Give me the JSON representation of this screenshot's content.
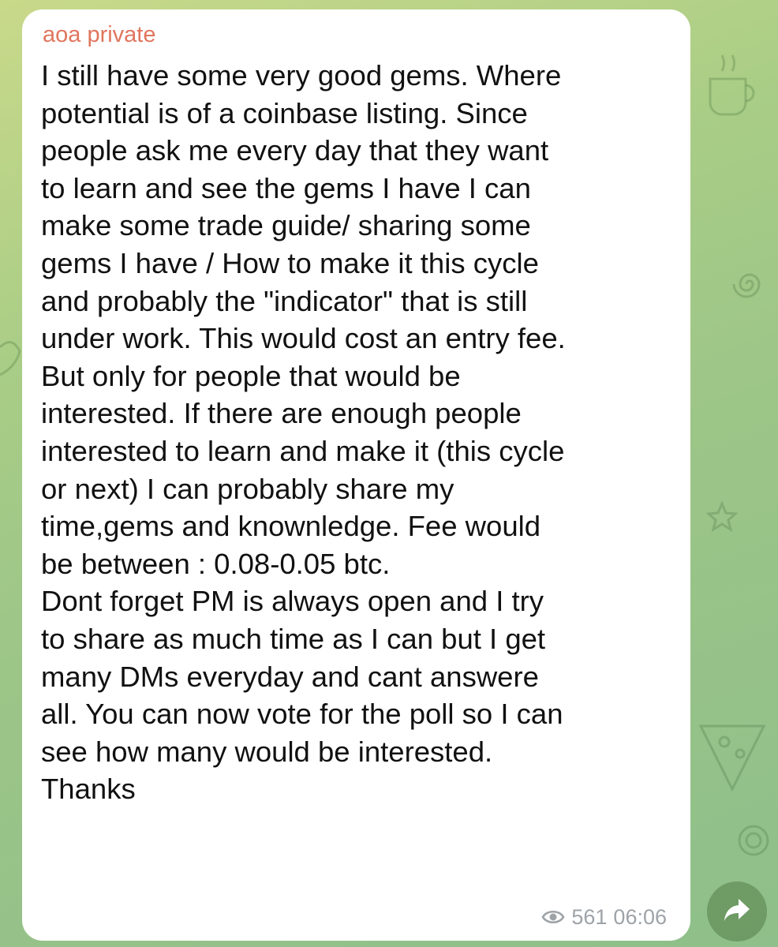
{
  "message": {
    "sender": "aoa private",
    "lines": [
      "I still have some very good gems. Where",
      "potential is of a coinbase listing. Since",
      "people ask me every day that they want",
      "to learn and see the gems I have I can",
      "make some trade guide/ sharing some",
      "gems I have / How to make it this cycle",
      "and probably the \"indicator\" that is still",
      "under work. This would cost an entry fee.",
      "But only for people that would be",
      "interested. If there are enough people",
      "interested to learn and make it (this cycle",
      "or next) I can probably share my",
      "time,gems and knownledge. Fee would",
      "be between : 0.08-0.05 btc.",
      "Dont forget PM is always open and I try",
      "to share as much time as I can but I get",
      "many DMs everyday and cant answere",
      "all. You can now vote for the poll so I can",
      "see how many would be interested.",
      "Thanks"
    ],
    "views": "561",
    "time": "06:06",
    "views_icon": "eye-icon"
  },
  "forward_button": {
    "icon": "forward-arrow-icon"
  },
  "colors": {
    "sender_name": "#e0765e",
    "bubble_background": "#ffffff",
    "meta_text": "#9ea3a8",
    "wallpaper_start": "#c9d98a",
    "wallpaper_end": "#8fbf8a"
  }
}
